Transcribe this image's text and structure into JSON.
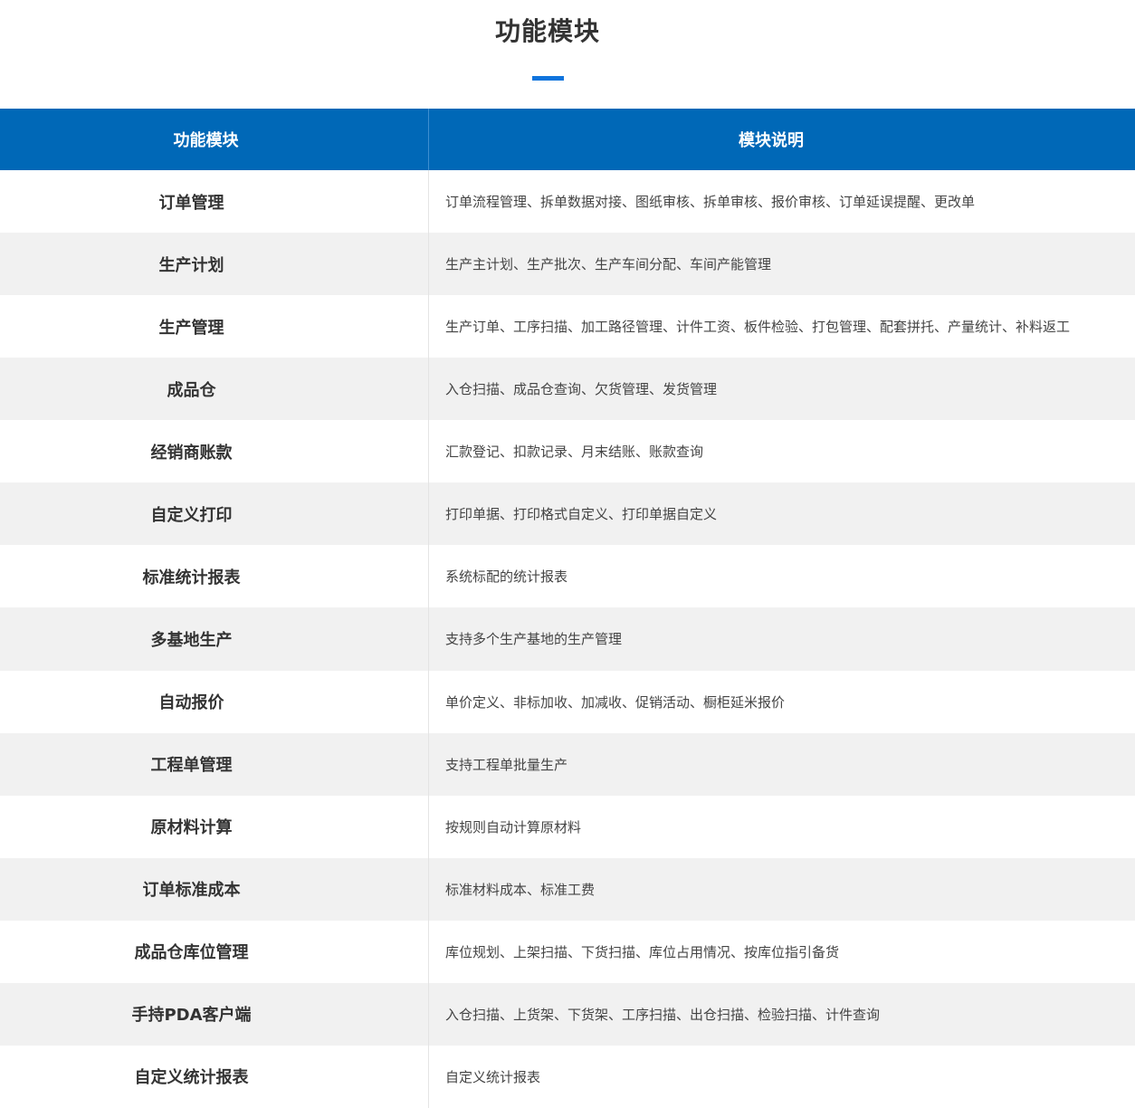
{
  "page": {
    "title": "功能模块",
    "accent_color": "#0f74dd",
    "header_color": "#0068b7",
    "stripe_color": "#f1f1f1"
  },
  "table": {
    "headers": [
      "功能模块",
      "模块说明"
    ],
    "rows": [
      {
        "module": "订单管理",
        "desc": "订单流程管理、拆单数据对接、图纸审核、拆单审核、报价审核、订单延误提醒、更改单"
      },
      {
        "module": "生产计划",
        "desc": "生产主计划、生产批次、生产车间分配、车间产能管理"
      },
      {
        "module": "生产管理",
        "desc": "生产订单、工序扫描、加工路径管理、计件工资、板件检验、打包管理、配套拼托、产量统计、补料返工"
      },
      {
        "module": "成品仓",
        "desc": "入仓扫描、成品仓查询、欠货管理、发货管理"
      },
      {
        "module": "经销商账款",
        "desc": "汇款登记、扣款记录、月末结账、账款查询"
      },
      {
        "module": "自定义打印",
        "desc": "打印单据、打印格式自定义、打印单据自定义"
      },
      {
        "module": "标准统计报表",
        "desc": "系统标配的统计报表"
      },
      {
        "module": "多基地生产",
        "desc": "支持多个生产基地的生产管理"
      },
      {
        "module": "自动报价",
        "desc": "单价定义、非标加收、加减收、促销活动、橱柜延米报价"
      },
      {
        "module": "工程单管理",
        "desc": "支持工程单批量生产"
      },
      {
        "module": "原材料计算",
        "desc": "按规则自动计算原材料"
      },
      {
        "module": "订单标准成本",
        "desc": "标准材料成本、标准工费"
      },
      {
        "module": "成品仓库位管理",
        "desc": "库位规划、上架扫描、下货扫描、库位占用情况、按库位指引备货"
      },
      {
        "module": "手持PDA客户端",
        "desc": "入仓扫描、上货架、下货架、工序扫描、出仓扫描、检验扫描、计件查询"
      },
      {
        "module": "自定义统计报表",
        "desc": "自定义统计报表"
      }
    ]
  }
}
